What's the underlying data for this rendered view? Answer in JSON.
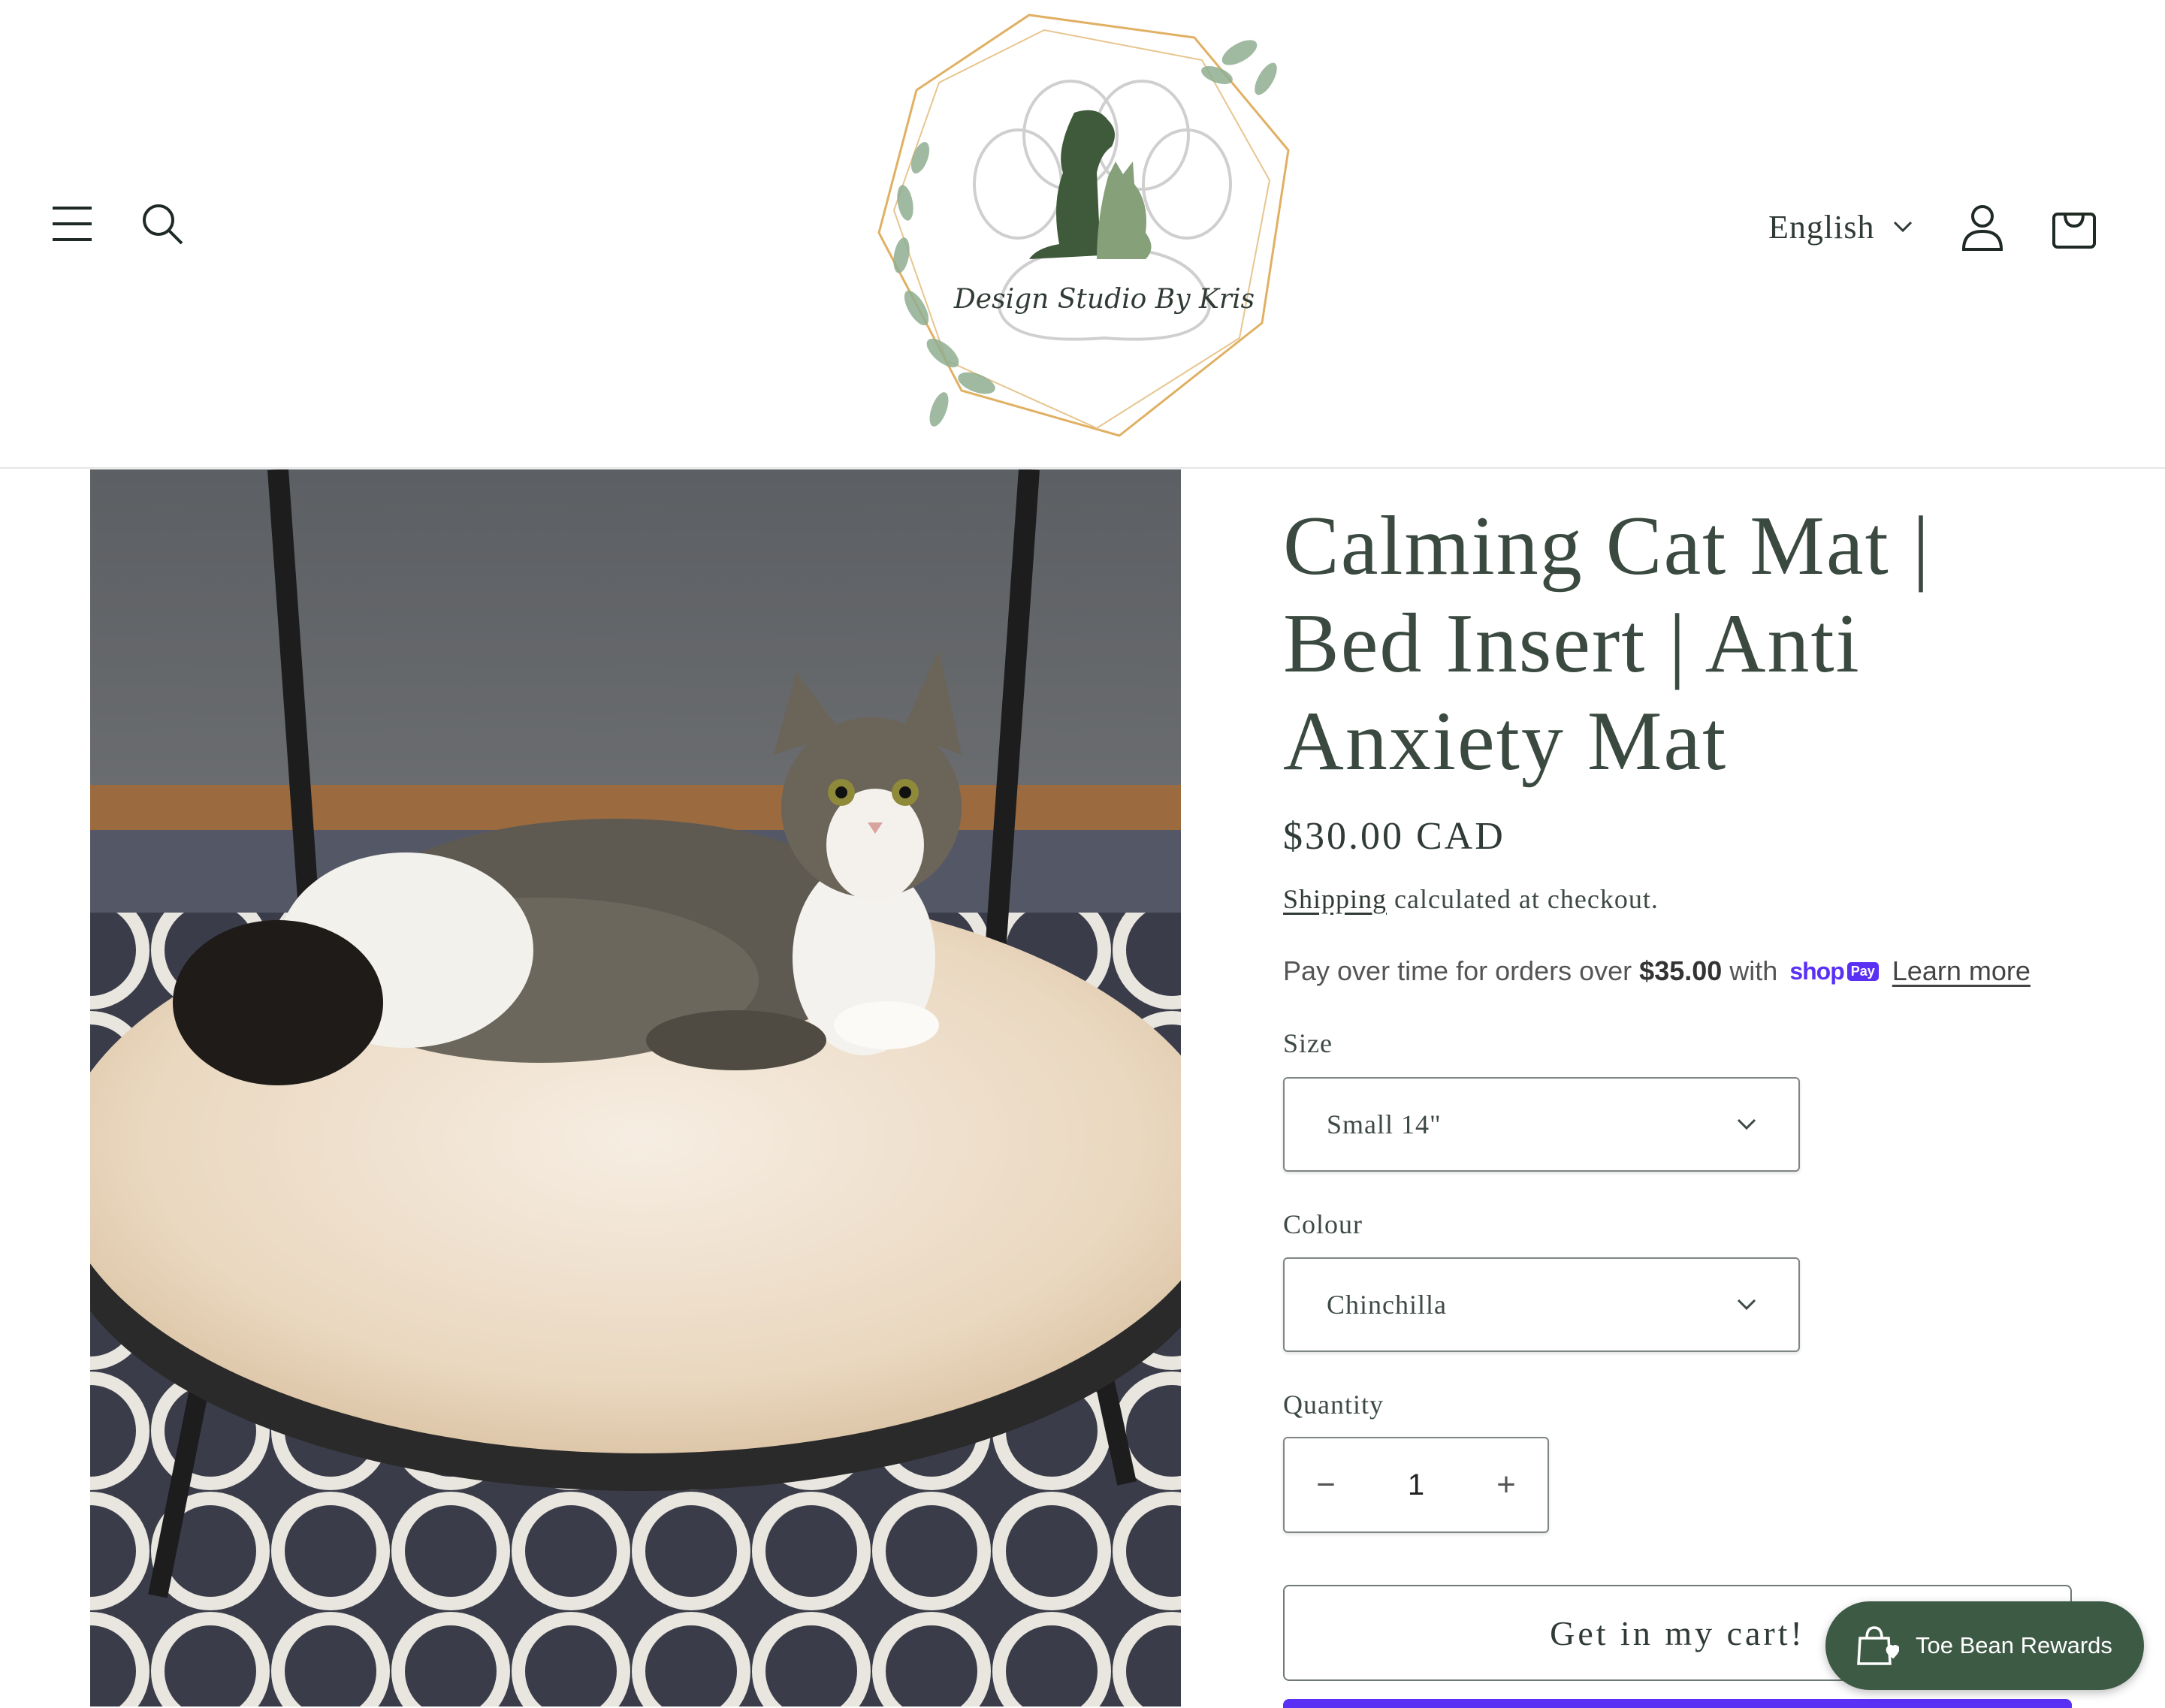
{
  "header": {
    "brand_logo_text": "Design Studio By Kris",
    "language": "English"
  },
  "product": {
    "title": "Calming Cat Mat | Bed Insert | Anti Anxiety Mat",
    "title_lines": [
      "Calming Cat Mat |",
      "Bed Insert | Anti",
      "Anxiety Mat"
    ],
    "price": "$30.00 CAD",
    "shipping_link": "Shipping",
    "shipping_text": " calculated at checkout.",
    "installments": {
      "prefix": "Pay over time for orders over",
      "amount": "$35.00",
      "with": "with",
      "shop_word": "shop",
      "pay_badge": "Pay",
      "learn_more": "Learn more"
    },
    "size": {
      "label": "Size",
      "selected": "Small 14\""
    },
    "colour": {
      "label": "Colour",
      "selected": "Chinchilla"
    },
    "quantity": {
      "label": "Quantity",
      "value": "1",
      "decrease": "−",
      "increase": "+"
    },
    "add_to_cart": "Get in my cart!"
  },
  "rewards_widget": {
    "label": "Toe Bean Rewards"
  },
  "colors": {
    "text": "#2f3b34",
    "title": "#3b4a41",
    "shop_pay": "#5a31f4",
    "rewards_bg": "#3d5a45",
    "logo_green": "#3f5a3a",
    "logo_gold": "#e0b063"
  }
}
